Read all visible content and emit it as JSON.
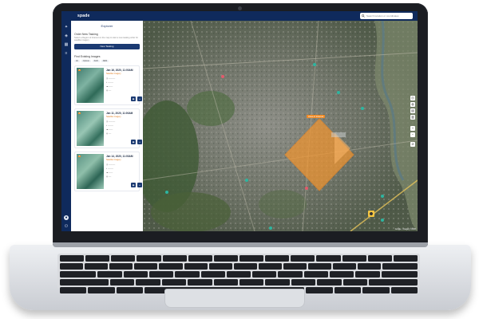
{
  "app": {
    "logo_text": "spade",
    "search_placeholder": "Search location or coordinates"
  },
  "rail_icons": [
    "pin-icon",
    "layers-icon",
    "grid-icon",
    "list-icon"
  ],
  "panel": {
    "title": "Explorer",
    "section_title": "Order New Tasking",
    "section_desc": "Select a Region of Interest on the map to start a new tasking order for satellite imagery",
    "primary_button": "New Tasking",
    "list_title": "Find Existing Images",
    "filters": [
      "All",
      "Optical",
      "SAR",
      "DEM"
    ],
    "cards": [
      {
        "date": "Jan 16, 2020, 11:00AM",
        "sub": "Satellite Imagery"
      },
      {
        "date": "Jan 11, 2020, 11:00AM",
        "sub": "Satellite Imagery"
      },
      {
        "date": "Jan 14, 2020, 11:00AM",
        "sub": "Satellite Imagery"
      }
    ]
  },
  "map": {
    "aoi_label": "Area of Interest",
    "attribution": "Google · Imagery ©2020"
  },
  "colors": {
    "nav": "#0f2a5c",
    "accent": "#f08a24",
    "aoi_fill": "#f5962e"
  }
}
